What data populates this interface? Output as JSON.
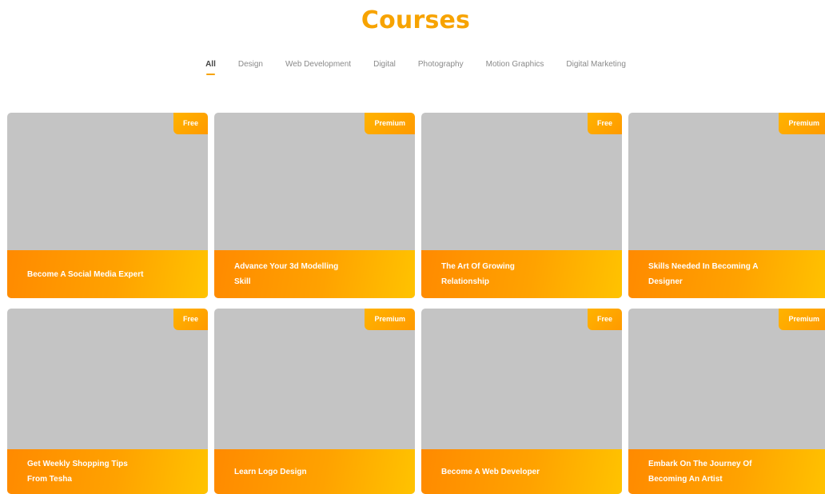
{
  "page": {
    "title": "Courses"
  },
  "filters": [
    {
      "label": "All",
      "active": true
    },
    {
      "label": "Design",
      "active": false
    },
    {
      "label": "Web Development",
      "active": false
    },
    {
      "label": "Digital",
      "active": false
    },
    {
      "label": "Photography",
      "active": false
    },
    {
      "label": "Motion Graphics",
      "active": false
    },
    {
      "label": "Digital Marketing",
      "active": false
    }
  ],
  "courses": [
    {
      "badge": "Free",
      "title": "Become A Social Media Expert"
    },
    {
      "badge": "Premium",
      "title": "Advance Your 3d Modelling Skill"
    },
    {
      "badge": "Free",
      "title": "The Art Of Growing Relationship"
    },
    {
      "badge": "Premium",
      "title": "Skills Needed In Becoming A Designer"
    },
    {
      "badge": "Free",
      "title": "Get Weekly Shopping Tips From Tesha"
    },
    {
      "badge": "Premium",
      "title": "Learn Logo Design"
    },
    {
      "badge": "Free",
      "title": "Become A Web Developer"
    },
    {
      "badge": "Premium",
      "title": "Embark On The Journey Of Becoming An Artist"
    }
  ],
  "colors": {
    "accent": "#f7a300",
    "card_placeholder": "#c4c4c4",
    "footer_gradient_start": "#ff8a00",
    "footer_gradient_end": "#ffc300"
  }
}
